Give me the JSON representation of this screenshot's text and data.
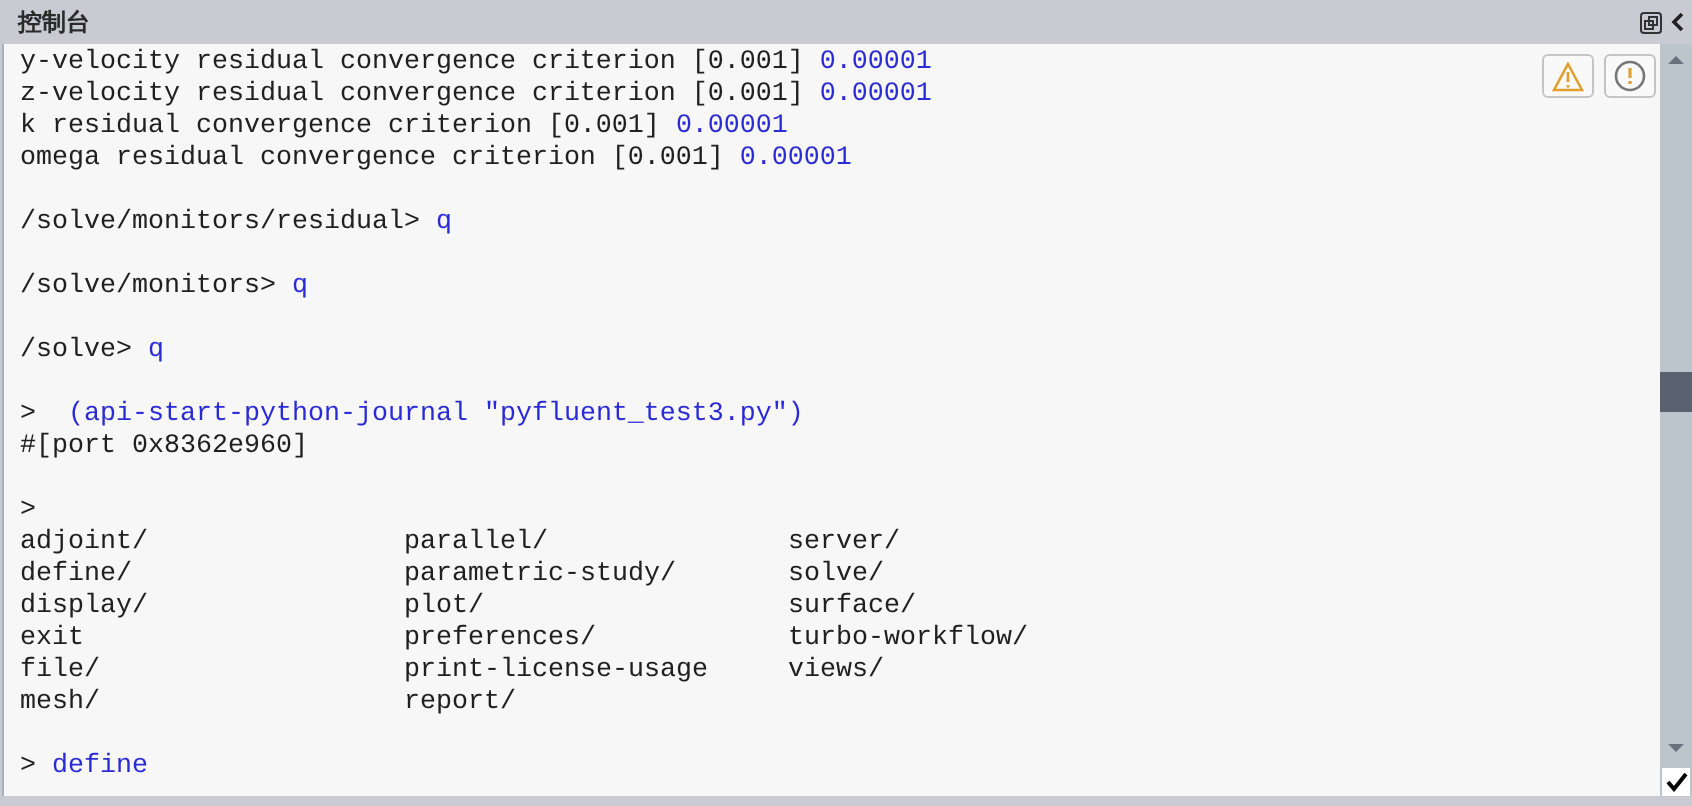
{
  "panel": {
    "title": "控制台"
  },
  "console": {
    "lines": [
      {
        "kind": "text",
        "segments": [
          {
            "kind": "output",
            "text": "y-velocity residual convergence criterion [0.001] "
          },
          {
            "kind": "input",
            "text": "0.00001"
          }
        ]
      },
      {
        "kind": "text",
        "segments": [
          {
            "kind": "output",
            "text": "z-velocity residual convergence criterion [0.001] "
          },
          {
            "kind": "input",
            "text": "0.00001"
          }
        ]
      },
      {
        "kind": "text",
        "segments": [
          {
            "kind": "output",
            "text": "k residual convergence criterion [0.001] "
          },
          {
            "kind": "input",
            "text": "0.00001"
          }
        ]
      },
      {
        "kind": "text",
        "segments": [
          {
            "kind": "output",
            "text": "omega residual convergence criterion [0.001] "
          },
          {
            "kind": "input",
            "text": "0.00001"
          }
        ]
      },
      {
        "kind": "blank"
      },
      {
        "kind": "text",
        "segments": [
          {
            "kind": "output",
            "text": "/solve/monitors/residual> "
          },
          {
            "kind": "input",
            "text": "q"
          }
        ]
      },
      {
        "kind": "blank"
      },
      {
        "kind": "text",
        "segments": [
          {
            "kind": "output",
            "text": "/solve/monitors> "
          },
          {
            "kind": "input",
            "text": "q"
          }
        ]
      },
      {
        "kind": "blank"
      },
      {
        "kind": "text",
        "segments": [
          {
            "kind": "output",
            "text": "/solve> "
          },
          {
            "kind": "input",
            "text": "q"
          }
        ]
      },
      {
        "kind": "blank"
      },
      {
        "kind": "text",
        "segments": [
          {
            "kind": "output",
            "text": ">  "
          },
          {
            "kind": "input",
            "text": "(api-start-python-journal \"pyfluent_test3.py\")"
          }
        ]
      },
      {
        "kind": "text",
        "segments": [
          {
            "kind": "output",
            "text": "#[port 0x8362e960]"
          }
        ]
      },
      {
        "kind": "blank"
      },
      {
        "kind": "text",
        "segments": [
          {
            "kind": "output",
            "text": ">"
          }
        ]
      },
      {
        "kind": "listing",
        "columns": [
          [
            "adjoint/",
            "define/",
            "display/",
            "exit",
            "file/",
            "mesh/"
          ],
          [
            "parallel/",
            "parametric-study/",
            "plot/",
            "preferences/",
            "print-license-usage",
            "report/"
          ],
          [
            "server/",
            "solve/",
            "surface/",
            "turbo-workflow/",
            "views/"
          ]
        ]
      },
      {
        "kind": "blank"
      },
      {
        "kind": "text",
        "segments": [
          {
            "kind": "output",
            "text": "> "
          },
          {
            "kind": "input",
            "text": "define"
          }
        ]
      }
    ]
  },
  "autoscroll": {
    "checked": true
  }
}
